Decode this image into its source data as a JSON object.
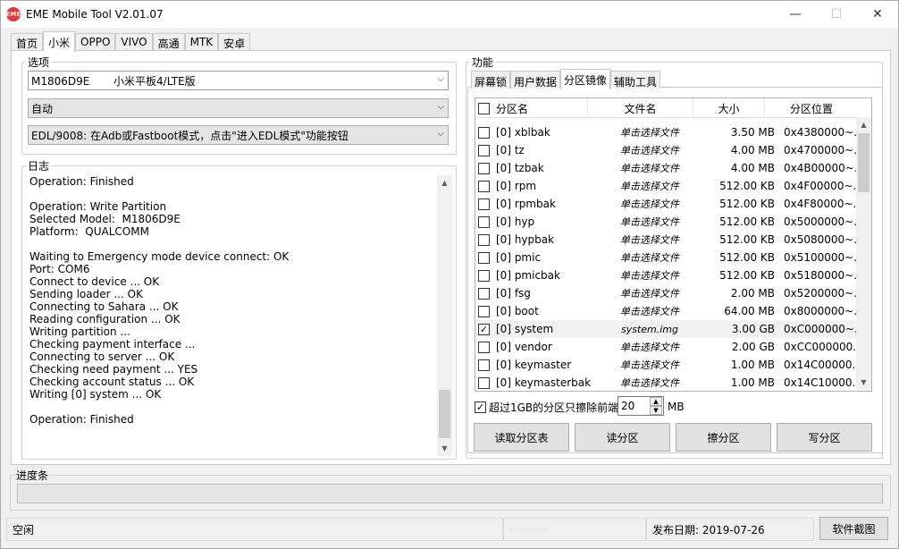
{
  "window": {
    "title": "EME Mobile Tool V2.01.07",
    "icon": "EME",
    "minimize": "—",
    "maximize": "☐",
    "close": "✕"
  },
  "main_tabs": [
    "首页",
    "小米",
    "OPPO",
    "VIVO",
    "高通",
    "MTK",
    "安卓"
  ],
  "active_main_tab": "小米",
  "options": {
    "legend": "选项",
    "model_value": "M1806D9E       小米平板4/LTE版",
    "mode_value": "自动",
    "edl_value": "EDL/9008: 在Adb或Fastboot模式，点击\"进入EDL模式\"功能按钮"
  },
  "log": {
    "legend": "日志",
    "lines": [
      "Operation: Finished",
      "",
      "Operation: Write Partition",
      "Selected Model:  M1806D9E",
      "Platform:  QUALCOMM",
      "",
      "Waiting to Emergency mode device connect: OK",
      "Port: COM6",
      "Connect to device ... OK",
      "Sending loader ... OK",
      "Connecting to Sahara ... OK",
      "Reading configuration ... OK",
      "Writing partition ...",
      "Checking payment interface ...",
      "Connecting to server ... OK",
      "Checking need payment ... YES",
      "Checking account status ... OK",
      "Writing [0] system ... OK",
      "",
      "Operation: Finished"
    ]
  },
  "functions": {
    "legend": "功能",
    "tabs": [
      "屏幕锁",
      "用户数据",
      "分区镜像",
      "辅助工具"
    ],
    "active_tab": "分区镜像",
    "table": {
      "headers": [
        "分区名",
        "文件名",
        "大小",
        "分区位置"
      ],
      "rows": [
        {
          "checked": false,
          "name": "[0] xblbak",
          "file": "单击选择文件",
          "size": "3.50 MB",
          "pos": "0x4380000~..."
        },
        {
          "checked": false,
          "name": "[0] tz",
          "file": "单击选择文件",
          "size": "4.00 MB",
          "pos": "0x4700000~..."
        },
        {
          "checked": false,
          "name": "[0] tzbak",
          "file": "单击选择文件",
          "size": "4.00 MB",
          "pos": "0x4B00000~..."
        },
        {
          "checked": false,
          "name": "[0] rpm",
          "file": "单击选择文件",
          "size": "512.00 KB",
          "pos": "0x4F00000~..."
        },
        {
          "checked": false,
          "name": "[0] rpmbak",
          "file": "单击选择文件",
          "size": "512.00 KB",
          "pos": "0x4F80000~..."
        },
        {
          "checked": false,
          "name": "[0] hyp",
          "file": "单击选择文件",
          "size": "512.00 KB",
          "pos": "0x5000000~..."
        },
        {
          "checked": false,
          "name": "[0] hypbak",
          "file": "单击选择文件",
          "size": "512.00 KB",
          "pos": "0x5080000~..."
        },
        {
          "checked": false,
          "name": "[0] pmic",
          "file": "单击选择文件",
          "size": "512.00 KB",
          "pos": "0x5100000~..."
        },
        {
          "checked": false,
          "name": "[0] pmicbak",
          "file": "单击选择文件",
          "size": "512.00 KB",
          "pos": "0x5180000~..."
        },
        {
          "checked": false,
          "name": "[0] fsg",
          "file": "单击选择文件",
          "size": "2.00 MB",
          "pos": "0x5200000~..."
        },
        {
          "checked": false,
          "name": "[0] boot",
          "file": "单击选择文件",
          "size": "64.00 MB",
          "pos": "0x8000000~..."
        },
        {
          "checked": true,
          "name": "[0] system",
          "file": "system.img",
          "size": "3.00 GB",
          "pos": "0xC000000~..."
        },
        {
          "checked": false,
          "name": "[0] vendor",
          "file": "单击选择文件",
          "size": "2.00 GB",
          "pos": "0xCC000000..."
        },
        {
          "checked": false,
          "name": "[0] keymaster",
          "file": "单击选择文件",
          "size": "1.00 MB",
          "pos": "0x14C00000..."
        },
        {
          "checked": false,
          "name": "[0] keymasterbak",
          "file": "单击选择文件",
          "size": "1.00 MB",
          "pos": "0x14C10000..."
        }
      ]
    },
    "erase_option": {
      "checked": true,
      "label": "超过1GB的分区只擦除前端",
      "value": "20",
      "unit": "MB"
    },
    "buttons": [
      "读取分区表",
      "读分区",
      "擦分区",
      "写分区"
    ]
  },
  "progress": {
    "label": "进度条",
    "value": 0
  },
  "status": {
    "state": "空闲",
    "account": "·········",
    "release": "发布日期:  2019-07-26",
    "screenshot_button": "软件截图"
  },
  "colors": {
    "accent_red": "#e2393b",
    "progress_green": "#06b025"
  }
}
